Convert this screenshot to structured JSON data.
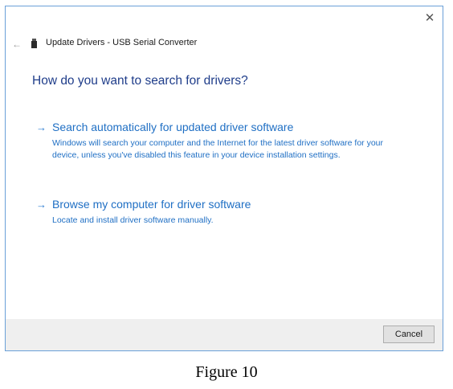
{
  "window": {
    "title": "Update Drivers - USB Serial Converter",
    "close_glyph": "✕",
    "back_glyph": "←",
    "device_icon": "usb-device-icon"
  },
  "main": {
    "heading": "How do you want to search for drivers?",
    "options": [
      {
        "arrow": "→",
        "title": "Search automatically for updated driver software",
        "description": "Windows will search your computer and the Internet for the latest driver software for your device, unless you've disabled this feature in your device installation settings."
      },
      {
        "arrow": "→",
        "title": "Browse my computer for driver software",
        "description": "Locate and install driver software manually."
      }
    ]
  },
  "footer": {
    "cancel_label": "Cancel"
  },
  "caption": "Figure 10",
  "colors": {
    "link": "#1f6fc4",
    "heading": "#1f3d8a",
    "border": "#6aa0d8",
    "footer_bg": "#efefef"
  }
}
